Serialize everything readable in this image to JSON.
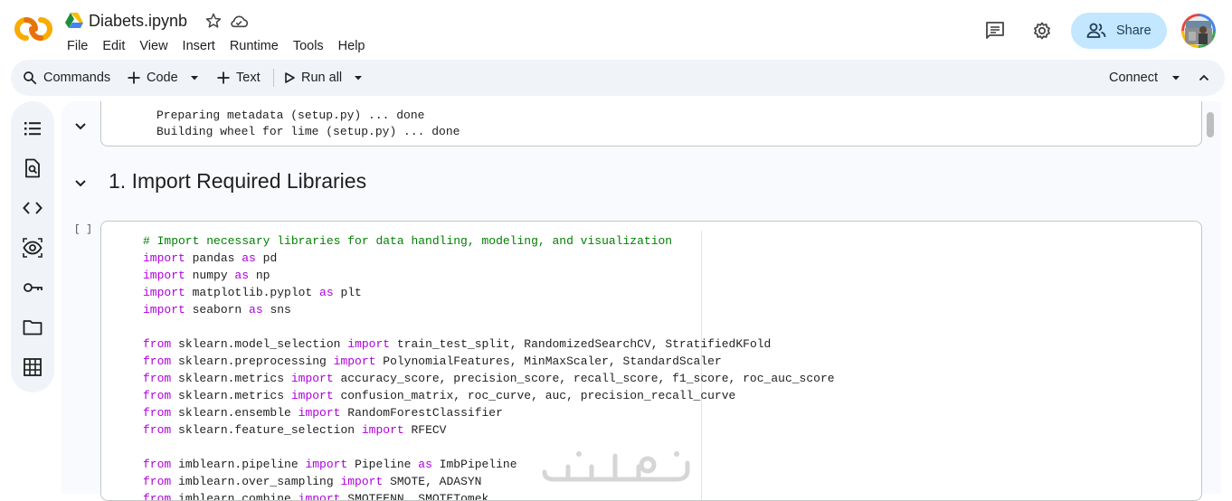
{
  "header": {
    "title": "Diabets.ipynb",
    "menu": [
      "File",
      "Edit",
      "View",
      "Insert",
      "Runtime",
      "Tools",
      "Help"
    ],
    "share_label": "Share",
    "icons": [
      "colab-logo-icon",
      "drive-icon",
      "star-icon",
      "cloud-icon",
      "comment-icon",
      "gear-icon",
      "share-people-icon",
      "avatar"
    ]
  },
  "toolbar": {
    "commands_label": "Commands",
    "code_label": "Code",
    "text_label": "Text",
    "run_all_label": "Run all",
    "connect_label": "Connect"
  },
  "sidebar": {
    "items": [
      "table-of-contents-icon",
      "find-icon",
      "code-snippets-icon",
      "variables-icon",
      "secrets-key-icon",
      "files-folder-icon",
      "data-table-icon"
    ]
  },
  "output": {
    "lines": [
      "Preparing metadata (setup.py) ... done",
      "Building wheel for lime (setup.py) ... done"
    ]
  },
  "section": {
    "heading": "1. Import Required Libraries"
  },
  "cell": {
    "run_indicator": "[ ]",
    "code": [
      [
        {
          "t": "# Import necessary libraries for data handling, modeling, and visualization",
          "c": "cm"
        }
      ],
      [
        {
          "t": "import",
          "c": "kw"
        },
        {
          "t": " pandas "
        },
        {
          "t": "as",
          "c": "kw"
        },
        {
          "t": " pd"
        }
      ],
      [
        {
          "t": "import",
          "c": "kw"
        },
        {
          "t": " numpy "
        },
        {
          "t": "as",
          "c": "kw"
        },
        {
          "t": " np"
        }
      ],
      [
        {
          "t": "import",
          "c": "kw"
        },
        {
          "t": " matplotlib.pyplot "
        },
        {
          "t": "as",
          "c": "kw"
        },
        {
          "t": " plt"
        }
      ],
      [
        {
          "t": "import",
          "c": "kw"
        },
        {
          "t": " seaborn "
        },
        {
          "t": "as",
          "c": "kw"
        },
        {
          "t": " sns"
        }
      ],
      [],
      [
        {
          "t": "from",
          "c": "kw"
        },
        {
          "t": " sklearn.model_selection "
        },
        {
          "t": "import",
          "c": "kw"
        },
        {
          "t": " train_test_split, RandomizedSearchCV, StratifiedKFold"
        }
      ],
      [
        {
          "t": "from",
          "c": "kw"
        },
        {
          "t": " sklearn.preprocessing "
        },
        {
          "t": "import",
          "c": "kw"
        },
        {
          "t": " PolynomialFeatures, MinMaxScaler, StandardScaler"
        }
      ],
      [
        {
          "t": "from",
          "c": "kw"
        },
        {
          "t": " sklearn.metrics "
        },
        {
          "t": "import",
          "c": "kw"
        },
        {
          "t": " accuracy_score, precision_score, recall_score, f1_score, roc_auc_score"
        }
      ],
      [
        {
          "t": "from",
          "c": "kw"
        },
        {
          "t": " sklearn.metrics "
        },
        {
          "t": "import",
          "c": "kw"
        },
        {
          "t": " confusion_matrix, roc_curve, auc, precision_recall_curve"
        }
      ],
      [
        {
          "t": "from",
          "c": "kw"
        },
        {
          "t": " sklearn.ensemble "
        },
        {
          "t": "import",
          "c": "kw"
        },
        {
          "t": " RandomForestClassifier"
        }
      ],
      [
        {
          "t": "from",
          "c": "kw"
        },
        {
          "t": " sklearn.feature_selection "
        },
        {
          "t": "import",
          "c": "kw"
        },
        {
          "t": " RFECV"
        }
      ],
      [],
      [
        {
          "t": "from",
          "c": "kw"
        },
        {
          "t": " imblearn.pipeline "
        },
        {
          "t": "import",
          "c": "kw"
        },
        {
          "t": " Pipeline "
        },
        {
          "t": "as",
          "c": "kw"
        },
        {
          "t": " ImbPipeline"
        }
      ],
      [
        {
          "t": "from",
          "c": "kw"
        },
        {
          "t": " imblearn.over_sampling "
        },
        {
          "t": "import",
          "c": "kw"
        },
        {
          "t": " SMOTE, ADASYN"
        }
      ],
      [
        {
          "t": "from",
          "c": "kw"
        },
        {
          "t": " imblearn.combine "
        },
        {
          "t": "import",
          "c": "kw"
        },
        {
          "t": " SMOTEENN, SMOTETomek"
        }
      ]
    ]
  },
  "watermark": "خمسات",
  "colors": {
    "accent": "#c2e7ff",
    "keyword": "#af00db",
    "comment": "#008000",
    "toolbar_bg": "#f0f4f9",
    "logo_orange": "#f9ab00",
    "logo_dark_orange": "#e8710a"
  }
}
